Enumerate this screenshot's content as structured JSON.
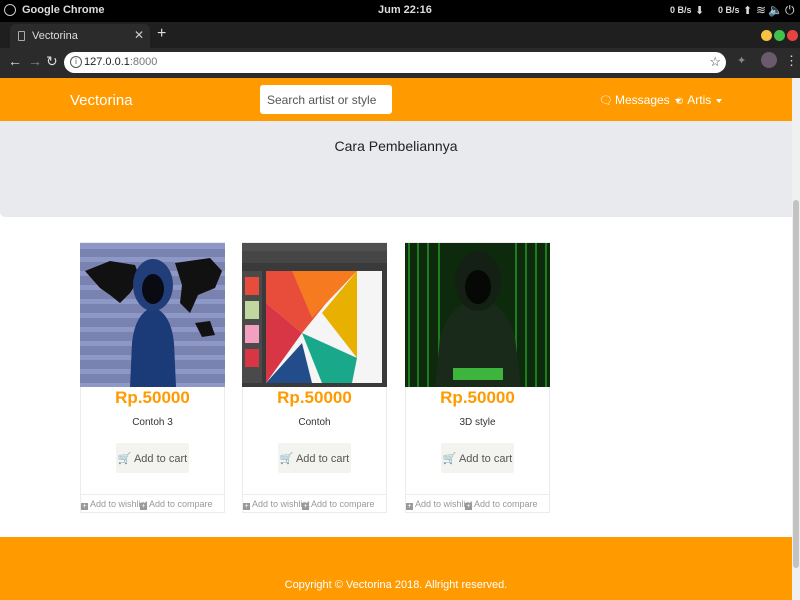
{
  "os": {
    "app_name": "Google Chrome",
    "clock": "Jum 22:16",
    "net_down": "0 B/s",
    "net_up": "0 B/s"
  },
  "browser": {
    "tab_title": "Vectorina",
    "url_host": "127.0.0.1",
    "url_port": ":8000"
  },
  "navbar": {
    "brand": "Vectorina",
    "search_placeholder": "Search artist or style",
    "messages_label": "Messages",
    "artis_label": "Artis"
  },
  "jumbotron": {
    "title": "Cara Pembeliannya"
  },
  "products": [
    {
      "price": "Rp.50000",
      "name": "Contoh 3",
      "cart_label": "Add to cart",
      "wishlist_label": "Add to wishlist",
      "compare_label": "Add to compare",
      "image": "hooded-figure-world-map"
    },
    {
      "price": "Rp.50000",
      "name": "Contoh",
      "cart_label": "Add to cart",
      "wishlist_label": "Add to wishlist",
      "compare_label": "Add to compare",
      "image": "presentation-editor-screenshot"
    },
    {
      "price": "Rp.50000",
      "name": "3D style",
      "cart_label": "Add to cart",
      "wishlist_label": "Add to wishlist",
      "compare_label": "Add to compare",
      "image": "hacker-green-code"
    }
  ],
  "footer": {
    "copyright": "Copyright © Vectorina 2018. Allright reserved."
  },
  "colors": {
    "brand_orange": "#ff9b00",
    "jumbotron_bg": "#e8eaed"
  }
}
